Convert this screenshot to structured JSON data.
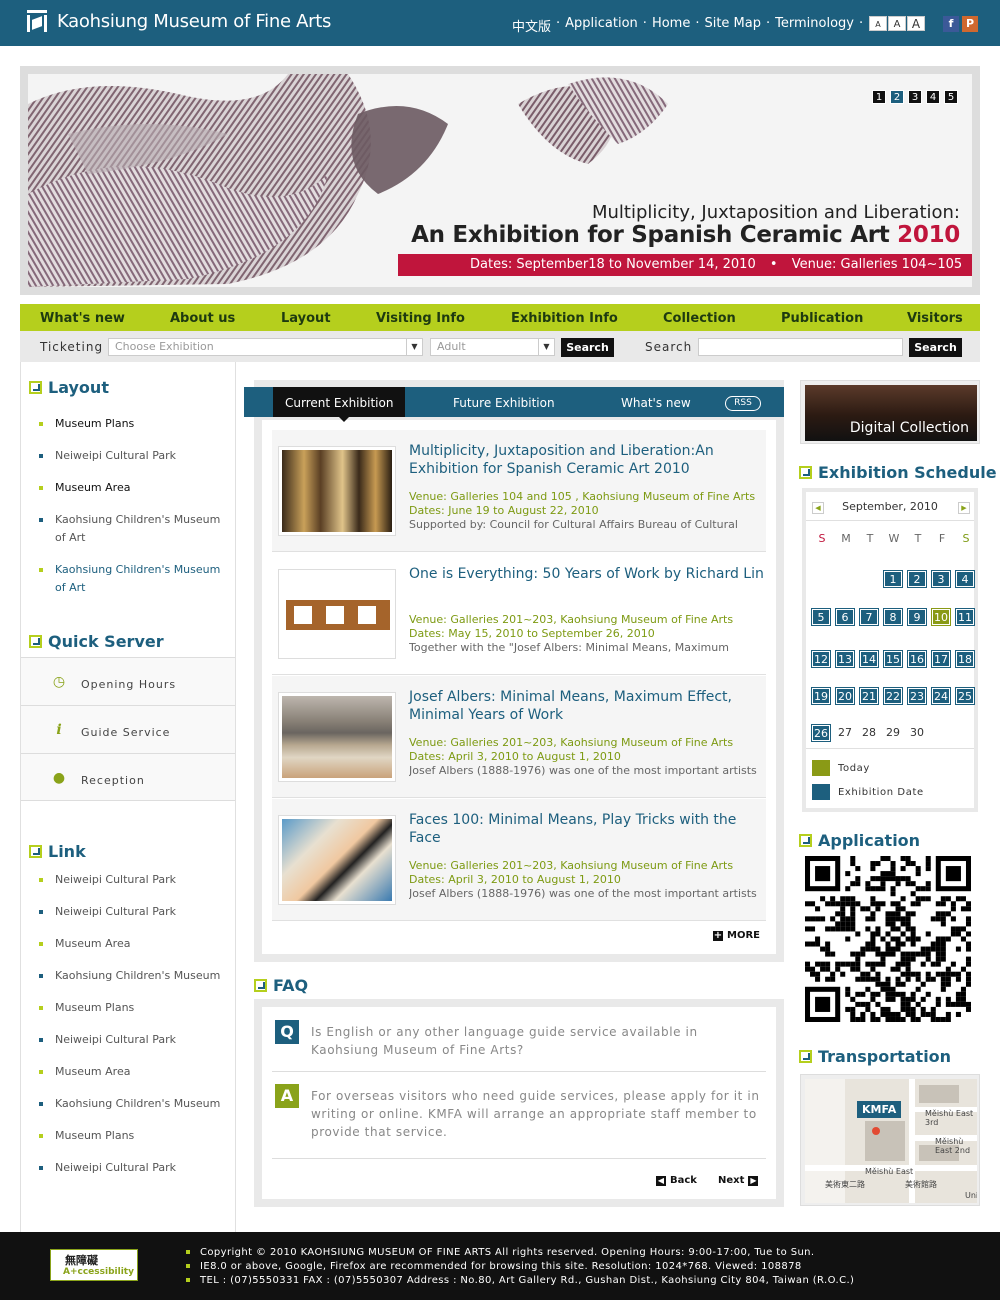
{
  "header": {
    "site_title": "Kaohsiung Museum of Fine Arts",
    "nav": [
      "中文版",
      "Application",
      "Home",
      "Site Map",
      "Terminology"
    ],
    "nav_sep": "·",
    "font_sizes": [
      "A",
      "A",
      "A"
    ],
    "social_icons": [
      "facebook-icon",
      "plurk-icon"
    ]
  },
  "banner": {
    "pages": [
      "1",
      "2",
      "3",
      "4",
      "5"
    ],
    "active_page": "2",
    "subtitle": "Multiplicity, Juxtaposition and Liberation:",
    "title": "An Exhibition for Spanish Ceramic Art",
    "year": "2010",
    "dates": "Dates: September18 to November 14, 2010",
    "venue": "Venue: Galleries 104~105",
    "dot": "•"
  },
  "main_nav": [
    "What's new",
    "About us",
    "Layout",
    "Visiting Info",
    "Exhibition Info",
    "Collection",
    "Publication",
    "Visitors"
  ],
  "subbar": {
    "ticketing_label": "Ticketing",
    "exhibition_select": "Choose Exhibition",
    "ticket_select": "Adult",
    "search_button": "Search",
    "search_label": "Search",
    "search_button2": "Search"
  },
  "left": {
    "layout_title": "Layout",
    "layout_links": [
      "Museum Plans",
      "Neiweipi Cultural Park",
      "Museum Area",
      "Kaohsiung Children's Museum of Art",
      "Kaohsiung Children's Museum of Art"
    ],
    "quick_title": "Quick Server",
    "quick_items": [
      "Opening Hours",
      "Guide Service",
      "Reception"
    ],
    "link_title": "Link",
    "links": [
      "Neiweipi Cultural Park",
      "Neiweipi Cultural Park",
      "Museum Area",
      "Kaohsiung Children's Museum",
      "Museum Plans",
      "Neiweipi Cultural Park",
      "Museum Area",
      "Kaohsiung Children's Museum",
      "Museum Plans",
      "Neiweipi Cultural Park"
    ]
  },
  "exhibitions": {
    "tabs": [
      "Current Exhibition",
      "Future Exhibition",
      "What's new"
    ],
    "rss": "RSS",
    "items": [
      {
        "title": "Multiplicity, Juxtaposition and Liberation:An Exhibition for Spanish Ceramic Art 2010",
        "venue": "Venue: Galleries 104 and 105 , Kaohsiung Museum of Fine Arts",
        "dates": "Dates: June 19 to August 22, 2010",
        "summary": "Supported by: Council for Cultural Affairs Bureau of Cultural"
      },
      {
        "title": "One is Everything: 50 Years of Work by Richard Lin",
        "venue": "Venue: Galleries 201~203, Kaohsiung Museum of Fine Arts",
        "dates": "Dates: May 15, 2010 to September 26, 2010",
        "summary": "Together with the \"Josef Albers: Minimal Means, Maximum"
      },
      {
        "title": "Josef Albers: Minimal Means, Maximum Effect, Minimal Years of Work",
        "venue": "Venue: Galleries 201~203, Kaohsiung Museum of Fine Arts",
        "dates": "Dates: April 3, 2010 to August 1, 2010",
        "summary": "Josef Albers (1888-1976) was one of the most important artists"
      },
      {
        "title": "Faces 100: Minimal Means, Play Tricks with the Face",
        "venue": "Venue: Galleries 201~203, Kaohsiung Museum of Fine Arts",
        "dates": "Dates: April 3, 2010 to August 1, 2010",
        "summary": "Josef Albers (1888-1976) was one of the most important artists"
      }
    ],
    "more": "MORE"
  },
  "faq": {
    "title": "FAQ",
    "q_badge": "Q",
    "question": "Is English or any other language guide service available in Kaohsiung Museum of Fine Arts?",
    "a_badge": "A",
    "answer": "For overseas visitors who need guide services, please apply for it in writing or online. KMFA will arrange an appropriate staff member to provide that service.",
    "back": "Back",
    "next": "Next"
  },
  "right": {
    "digital": "Digital Collection",
    "schedule_title": "Exhibition Schedule",
    "calendar_month": "September, 2010",
    "weekdays": [
      "S",
      "M",
      "T",
      "W",
      "T",
      "F",
      "S"
    ],
    "today": 10,
    "legend_today": "Today",
    "legend_exhibition": "Exhibition Date",
    "application_title": "Application",
    "transport_title": "Transportation",
    "map_label": "KMFA",
    "map_streets": [
      "Měishù East 3rd",
      "Měishù East 2nd",
      "Měishù East",
      "美術東二路",
      "美術館路",
      "Uni",
      "美術東三路",
      "美術"
    ]
  },
  "footer": {
    "acc_cn": "無障礙",
    "acc_en": "A+ccessibility",
    "line1": "Copyright © 2010  KAOHSIUNG MUSEUM OF FINE ARTS All rights reserved.  Opening Hours: 9:00-17:00, Tue to Sun.",
    "line2": "IE8.0 or above, Google, Firefox are recommended for browsing this site. Resolution: 1024*768. Viewed: 108878",
    "line3": "TEL : (07)5550331 FAX : (07)5550307 Address : No.80, Art Gallery Rd., Gushan Dist., Kaohsiung City 804, Taiwan (R.O.C.)"
  },
  "colors": {
    "brand_blue": "#1d5f7e",
    "lime": "#b5cf1d",
    "banner_red": "#c0153c"
  }
}
